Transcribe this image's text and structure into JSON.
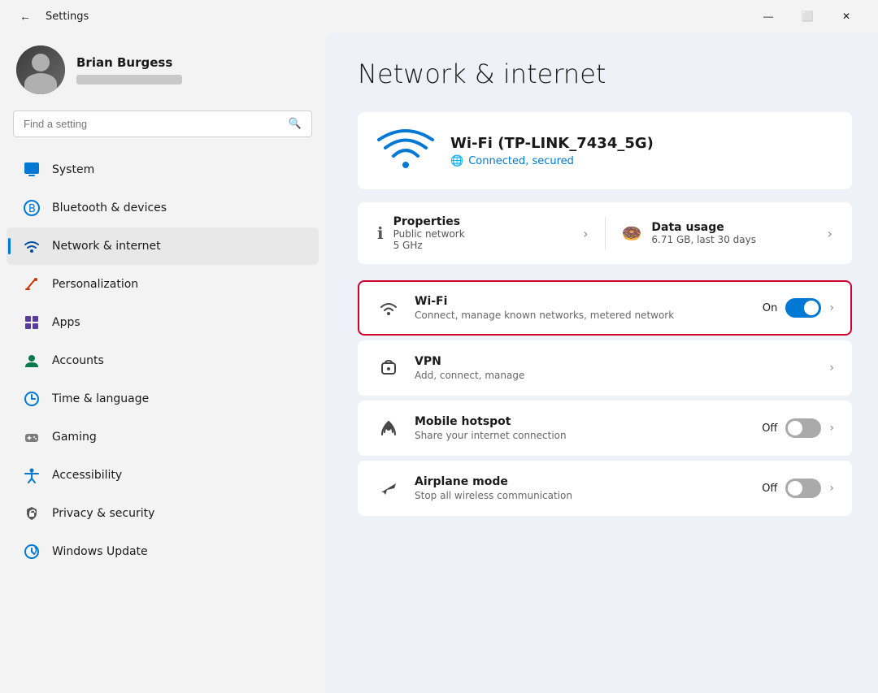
{
  "titleBar": {
    "title": "Settings",
    "backLabel": "←",
    "minimize": "—",
    "maximize": "⬜",
    "close": "✕"
  },
  "user": {
    "name": "Brian Burgess"
  },
  "search": {
    "placeholder": "Find a setting"
  },
  "sidebar": {
    "items": [
      {
        "id": "system",
        "label": "System",
        "icon": "🖥",
        "iconColor": "icon-system",
        "active": false
      },
      {
        "id": "bluetooth",
        "label": "Bluetooth & devices",
        "icon": "⬡",
        "iconColor": "icon-bluetooth",
        "active": false
      },
      {
        "id": "network",
        "label": "Network & internet",
        "icon": "◈",
        "iconColor": "icon-network",
        "active": true
      },
      {
        "id": "personalization",
        "label": "Personalization",
        "icon": "✏",
        "iconColor": "icon-personalization",
        "active": false
      },
      {
        "id": "apps",
        "label": "Apps",
        "icon": "⊞",
        "iconColor": "icon-apps",
        "active": false
      },
      {
        "id": "accounts",
        "label": "Accounts",
        "icon": "◉",
        "iconColor": "icon-accounts",
        "active": false
      },
      {
        "id": "time",
        "label": "Time & language",
        "icon": "⊕",
        "iconColor": "icon-time",
        "active": false
      },
      {
        "id": "gaming",
        "label": "Gaming",
        "icon": "🎮",
        "iconColor": "icon-gaming",
        "active": false
      },
      {
        "id": "accessibility",
        "label": "Accessibility",
        "icon": "✦",
        "iconColor": "icon-accessibility",
        "active": false
      },
      {
        "id": "privacy",
        "label": "Privacy & security",
        "icon": "⊛",
        "iconColor": "icon-privacy",
        "active": false
      },
      {
        "id": "update",
        "label": "Windows Update",
        "icon": "⟳",
        "iconColor": "icon-update",
        "active": false
      }
    ]
  },
  "main": {
    "title": "Network & internet",
    "wifiCard": {
      "networkName": "Wi-Fi (TP-LINK_7434_5G)",
      "status": "Connected, secured"
    },
    "properties": {
      "title": "Properties",
      "sub1": "Public network",
      "sub2": "5 GHz"
    },
    "dataUsage": {
      "title": "Data usage",
      "sub1": "6.71 GB, last 30 days"
    },
    "rows": [
      {
        "id": "wifi",
        "title": "Wi-Fi",
        "sub": "Connect, manage known networks, metered network",
        "toggle": "On",
        "toggleState": "on",
        "highlighted": true
      },
      {
        "id": "vpn",
        "title": "VPN",
        "sub": "Add, connect, manage",
        "toggle": null,
        "highlighted": false
      },
      {
        "id": "hotspot",
        "title": "Mobile hotspot",
        "sub": "Share your internet connection",
        "toggle": "Off",
        "toggleState": "off",
        "highlighted": false
      },
      {
        "id": "airplane",
        "title": "Airplane mode",
        "sub": "Stop all wireless communication",
        "toggle": "Off",
        "toggleState": "off",
        "highlighted": false
      }
    ]
  }
}
